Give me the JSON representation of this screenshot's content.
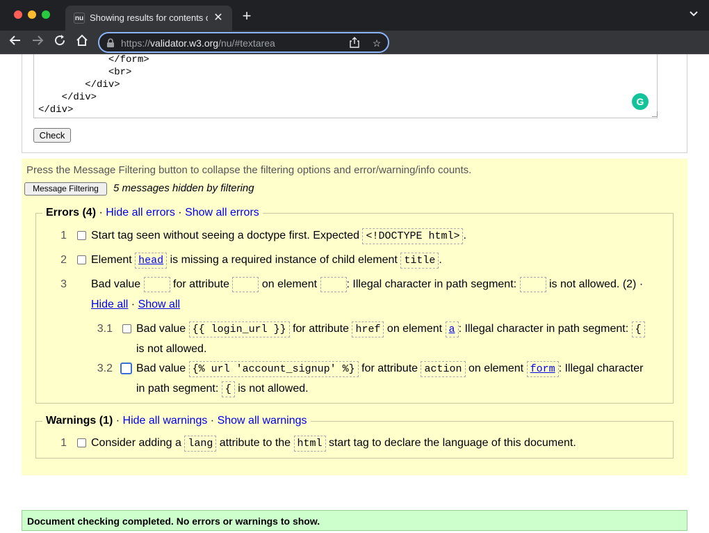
{
  "browser": {
    "tab_title": "Showing results for contents of",
    "tab_favicon": "nu",
    "url_prefix": "https://",
    "url_host": "validator.w3.org",
    "url_path": "/nu/#textarea",
    "icons": [
      "back-icon",
      "forward-icon",
      "reload-icon",
      "home-icon",
      "lock-icon",
      "share-icon",
      "star-icon",
      "extensions-icon",
      "profile-icon",
      "menu-icon"
    ]
  },
  "textarea": {
    "content": "            </form>\n            <br>\n        </div>\n    </div>\n</div>"
  },
  "check_button": "Check",
  "filter": {
    "note": "Press the Message Filtering button to collapse the filtering options and error/warning/info counts.",
    "button": "Message Filtering",
    "hidden": "5 messages hidden by filtering"
  },
  "errors": {
    "title": "Errors (4)",
    "sep": " · ",
    "hide_all": "Hide all errors",
    "show_all": "Show all errors",
    "m1": {
      "num": "1",
      "pre": "Start tag seen without seeing a doctype first. Expected ",
      "code": "<!DOCTYPE html>",
      "post": "."
    },
    "m2": {
      "num": "2",
      "pre": "Element ",
      "code1": "head",
      "mid": " is missing a required instance of child element ",
      "code2": "title",
      "post": "."
    },
    "m3": {
      "num": "3",
      "t1": "Bad value ",
      "t2": " for attribute ",
      "t3": " on element ",
      "t4": ": Illegal character in path segment: ",
      "t5": " is not allowed. (2) ·",
      "hide": "Hide all",
      "dot": " · ",
      "show": "Show all"
    },
    "m31": {
      "num": "3.1",
      "t1": "Bad value ",
      "c1": "{{ login_url }}",
      "t2": " for attribute ",
      "c2": "href",
      "t3": " on element ",
      "c3": "a",
      "t4": ": Illegal character in path segment: ",
      "c4": "{",
      "t5": "is not allowed."
    },
    "m32": {
      "num": "3.2",
      "t1": "Bad value ",
      "c1": "{% url 'account_signup' %}",
      "t2": " for attribute ",
      "c2": "action",
      "t3": " on element ",
      "c3": "form",
      "t4": ": Illegal character",
      "t5": "in path segment: ",
      "c4": "{",
      "t6": " is not allowed."
    }
  },
  "warnings": {
    "title": "Warnings (1)",
    "sep": " · ",
    "hide_all": "Hide all warnings",
    "show_all": "Show all warnings",
    "m1": {
      "num": "1",
      "t1": "Consider adding a ",
      "c1": "lang",
      "t2": " attribute to the ",
      "c2": "html",
      "t3": " start tag to declare the language of this document."
    }
  },
  "success": "Document checking completed. No errors or warnings to show."
}
